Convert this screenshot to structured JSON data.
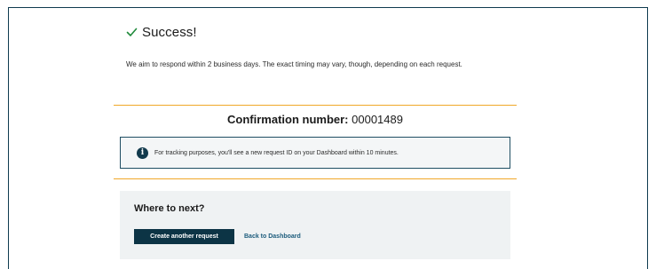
{
  "success": {
    "icon": "checkmark-icon",
    "title": "Success!",
    "message": "We aim to respond within 2 business days. The exact timing may vary, though, depending on each request."
  },
  "confirmation": {
    "label": "Confirmation number:",
    "number": "00001489"
  },
  "info": {
    "icon": "info-icon",
    "icon_glyph": "i",
    "text": "For tracking purposes, you'll see a new request ID on your Dashboard within 10 minutes."
  },
  "next": {
    "title": "Where to next?",
    "create_label": "Create another request",
    "back_label": "Back to Dashboard"
  },
  "colors": {
    "accent_dark": "#0c3445",
    "success_green": "#1f8a3b",
    "divider_orange": "#f0a828",
    "link_blue": "#1c5c7c"
  }
}
